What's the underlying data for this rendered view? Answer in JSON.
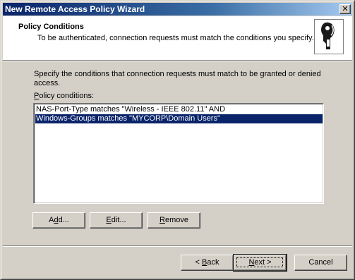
{
  "window": {
    "title": "New Remote Access Policy Wizard",
    "close_glyph": "✕"
  },
  "header": {
    "title": "Policy Conditions",
    "subtitle": "To be authenticated, connection requests must match the conditions you specify.",
    "icon": "wizard-key-icon"
  },
  "body": {
    "instructions": "Specify the conditions that connection requests must match to be granted or denied access.",
    "list_label_accel": "P",
    "list_label_rest": "olicy conditions:",
    "conditions": [
      "NAS-Port-Type matches \"Wireless - IEEE 802.11\" AND",
      "Windows-Groups matches \"MYCORP\\Domain Users\""
    ],
    "selected_index": 1
  },
  "buttons": {
    "add_pre": "A",
    "add_accel": "d",
    "add_post": "d...",
    "edit_accel": "E",
    "edit_post": "dit...",
    "remove_accel": "R",
    "remove_post": "emove",
    "back_pre": "< ",
    "back_accel": "B",
    "back_post": "ack",
    "next_accel": "N",
    "next_post": "ext >",
    "cancel": "Cancel"
  }
}
